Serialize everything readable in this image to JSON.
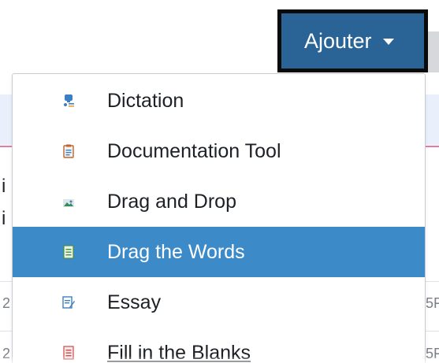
{
  "toolbar": {
    "add_button_label": "Ajouter"
  },
  "background": {
    "left_fragments": [
      "i",
      "i",
      "2",
      "2"
    ],
    "right_fragments": [
      "5F",
      "5F"
    ]
  },
  "menu": {
    "items": [
      {
        "label": "Dictation",
        "icon": "dictation-icon",
        "active": false
      },
      {
        "label": "Documentation Tool",
        "icon": "documentation-tool-icon",
        "active": false
      },
      {
        "label": "Drag and Drop",
        "icon": "drag-and-drop-icon",
        "active": false
      },
      {
        "label": "Drag the Words",
        "icon": "drag-the-words-icon",
        "active": true
      },
      {
        "label": "Essay",
        "icon": "essay-icon",
        "active": false
      },
      {
        "label": "Fill in the Blanks",
        "icon": "fill-in-the-blanks-icon",
        "active": false
      }
    ]
  },
  "colors": {
    "button_bg": "#2a6496",
    "active_item_bg": "#3c8ac8",
    "accent_pink": "#e57aa6"
  }
}
